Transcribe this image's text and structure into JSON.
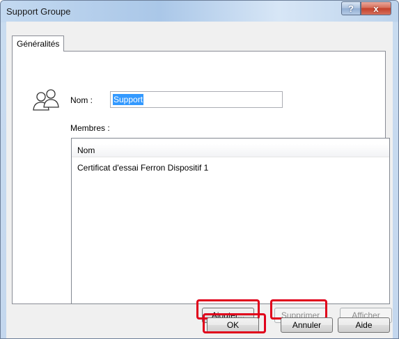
{
  "window": {
    "title": "Support Groupe",
    "help_glyph": "?",
    "close_glyph": "x"
  },
  "tab": {
    "label": "Généralités"
  },
  "form": {
    "icon": "group-icon",
    "name_label": "Nom :",
    "name_value": "Support",
    "members_label": "Membres :"
  },
  "members_list": {
    "columns": [
      "Nom"
    ],
    "rows": [
      "Certificat d'essai Ferron Dispositif  1"
    ]
  },
  "list_buttons": {
    "add": "Ajouter...",
    "remove": "Supprimer",
    "show": "Afficher"
  },
  "dialog_buttons": {
    "ok": "OK",
    "cancel": "Annuler",
    "help": "Aide"
  },
  "highlight_color": "#e0001b"
}
